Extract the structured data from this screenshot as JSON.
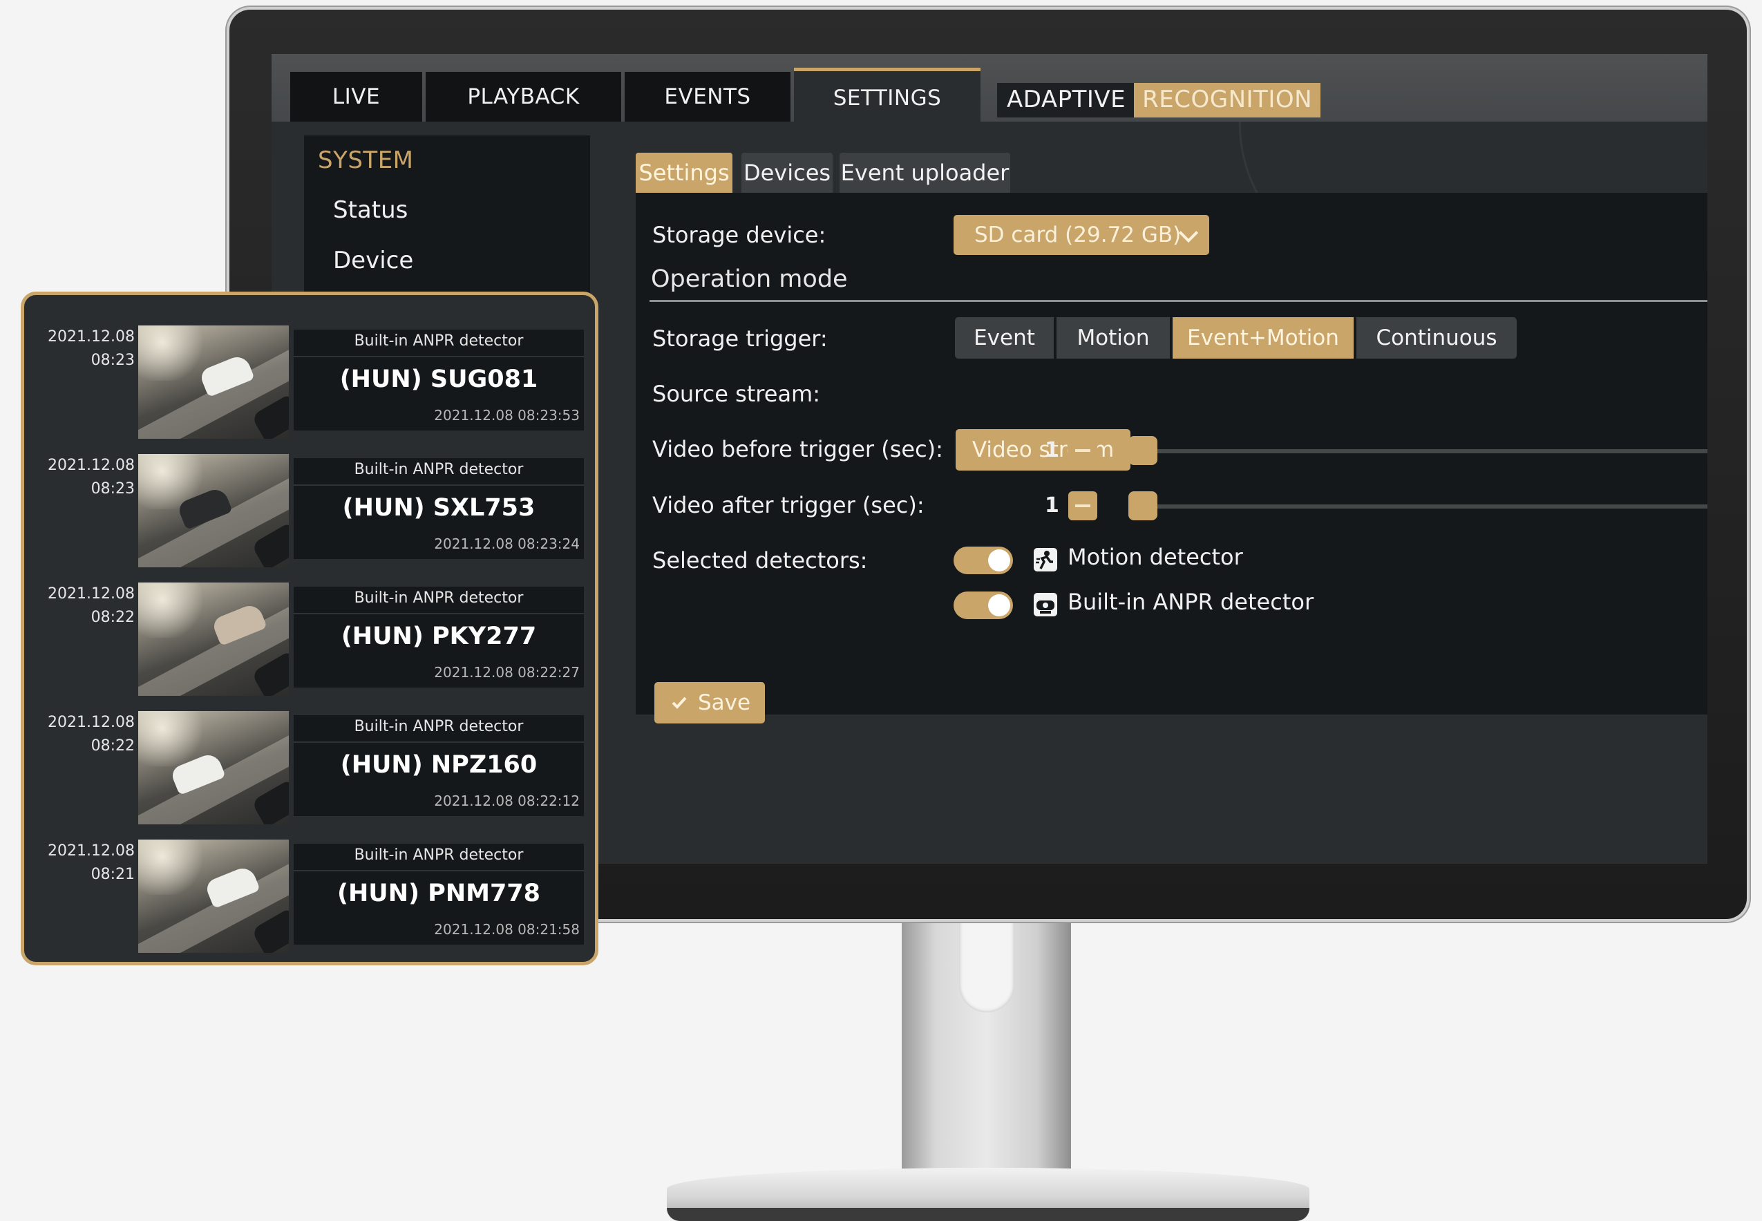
{
  "nav": {
    "tabs": [
      {
        "label": "LIVE"
      },
      {
        "label": "PLAYBACK"
      },
      {
        "label": "EVENTS"
      },
      {
        "label": "SETTINGS"
      }
    ],
    "active_tab": "SETTINGS"
  },
  "brand": {
    "part1": "ADAPTIVE",
    "part2": "RECOGNITION"
  },
  "system_menu": {
    "title": "SYSTEM",
    "items": [
      {
        "label": "Status"
      },
      {
        "label": "Device"
      }
    ]
  },
  "subtabs": [
    {
      "label": "Settings"
    },
    {
      "label": "Devices"
    },
    {
      "label": "Event uploader"
    }
  ],
  "settings": {
    "storage_device_label": "Storage device:",
    "storage_device_value": "SD card (29.72 GB)",
    "operation_mode_title": "Operation mode",
    "storage_trigger_label": "Storage trigger:",
    "storage_trigger_options": [
      {
        "label": "Event"
      },
      {
        "label": "Motion"
      },
      {
        "label": "Event+Motion"
      },
      {
        "label": "Continuous"
      }
    ],
    "storage_trigger_selected": "Event+Motion",
    "source_stream_label": "Source stream:",
    "source_stream_value": "Video stream",
    "video_before_label": "Video before trigger (sec):",
    "video_before_value": "1",
    "video_after_label": "Video after trigger (sec):",
    "video_after_value": "1",
    "selected_detectors_label": "Selected detectors:",
    "detectors": [
      {
        "label": "Motion detector",
        "enabled": true,
        "icon": "motion-detector-icon"
      },
      {
        "label": "Built-in ANPR detector",
        "enabled": true,
        "icon": "anpr-camera-icon"
      }
    ],
    "save_label": "Save"
  },
  "events": [
    {
      "date": "2021.12.08",
      "time": "08:23",
      "detector": "Built-in ANPR detector",
      "plate": "(HUN) SUG081",
      "timestamp": "2021.12.08 08:23:53"
    },
    {
      "date": "2021.12.08",
      "time": "08:23",
      "detector": "Built-in ANPR detector",
      "plate": "(HUN) SXL753",
      "timestamp": "2021.12.08 08:23:24"
    },
    {
      "date": "2021.12.08",
      "time": "08:22",
      "detector": "Built-in ANPR detector",
      "plate": "(HUN) PKY277",
      "timestamp": "2021.12.08 08:22:27"
    },
    {
      "date": "2021.12.08",
      "time": "08:22",
      "detector": "Built-in ANPR detector",
      "plate": "(HUN) NPZ160",
      "timestamp": "2021.12.08 08:22:12"
    },
    {
      "date": "2021.12.08",
      "time": "08:21",
      "detector": "Built-in ANPR detector",
      "plate": "(HUN) PNM778",
      "timestamp": "2021.12.08 08:21:58"
    }
  ],
  "colors": {
    "accent": "#c9a56a",
    "panel": "#15181a",
    "background": "#2a2d30",
    "tab_dark": "#111315"
  }
}
